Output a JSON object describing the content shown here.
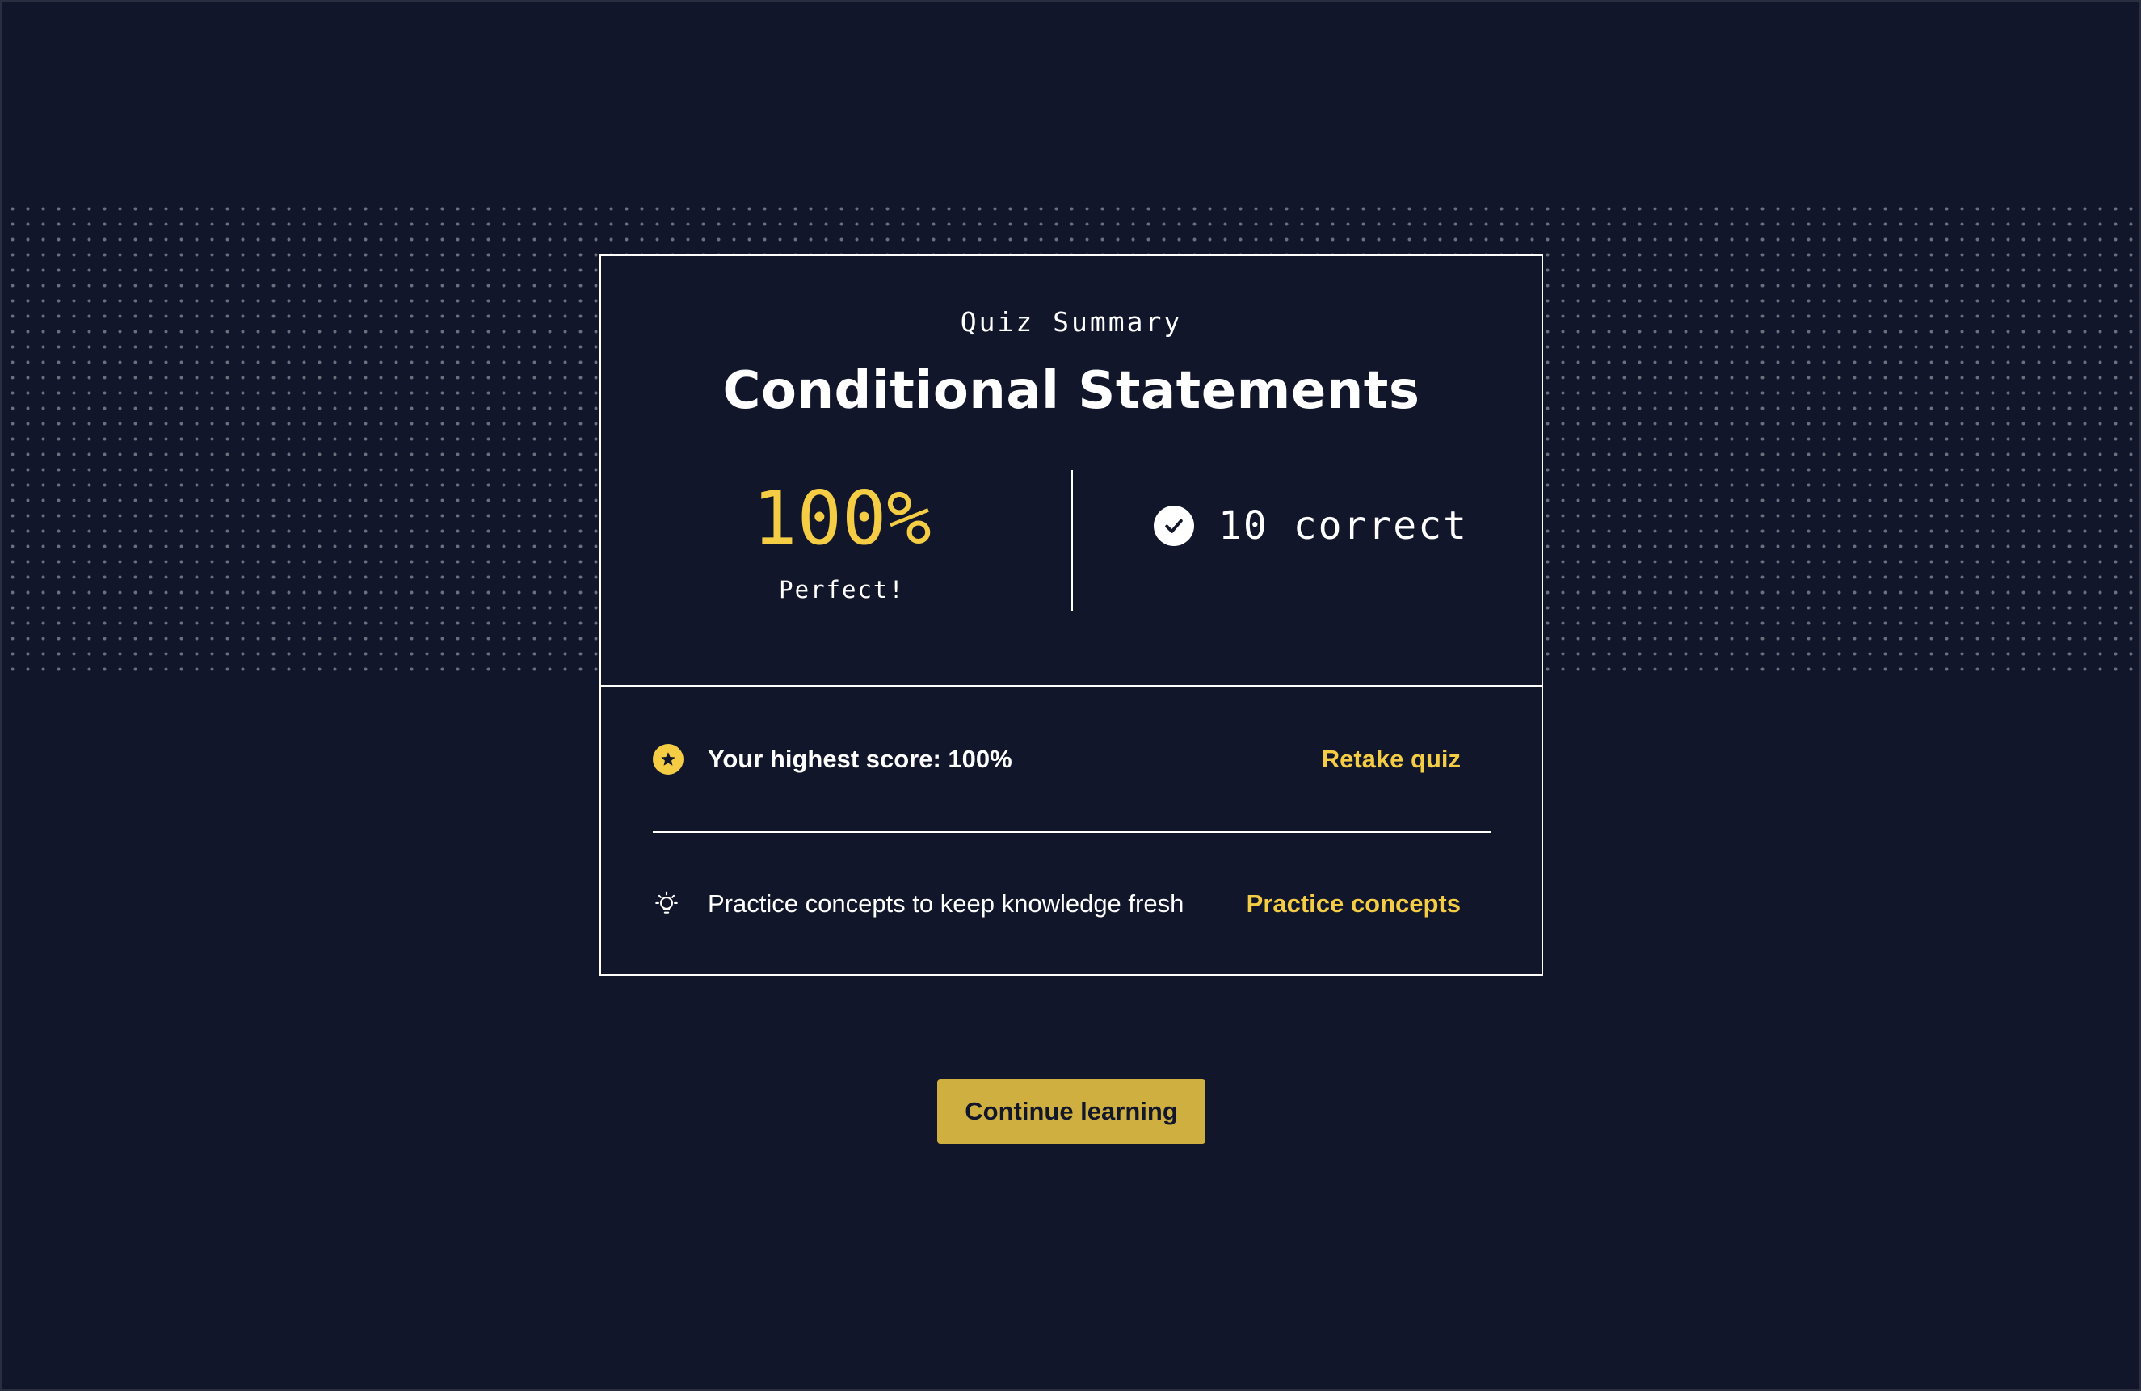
{
  "summary": {
    "eyebrow": "Quiz Summary",
    "title": "Conditional Statements",
    "score_value": "100%",
    "score_caption": "Perfect!",
    "correct_text": "10 correct"
  },
  "highest_score": {
    "icon": "star-icon",
    "label": "Your highest score: 100%",
    "link_label": "Retake quiz"
  },
  "practice": {
    "icon": "lightbulb-icon",
    "label": "Practice concepts to keep knowledge fresh",
    "link_label": "Practice concepts"
  },
  "actions": {
    "continue_label": "Continue learning"
  },
  "colors": {
    "background": "#12162b",
    "accent": "#f4cd45",
    "button": "#cfaf3f",
    "text": "#ffffff"
  }
}
